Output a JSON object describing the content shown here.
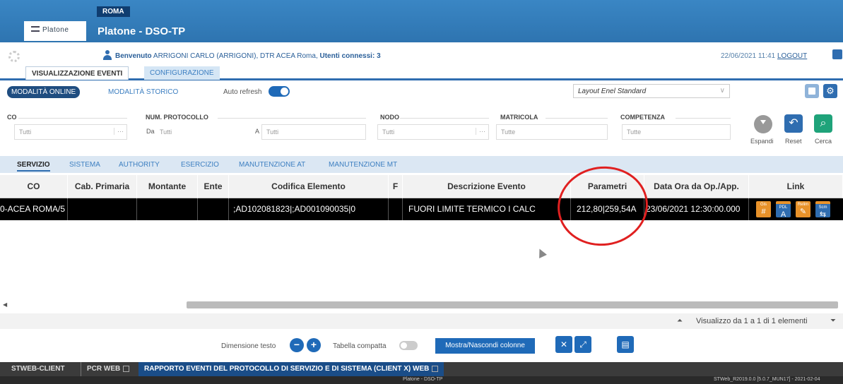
{
  "header": {
    "city_tag": "ROMA",
    "logo_text": "Platone",
    "title": "Platone - DSO-TP"
  },
  "userbar": {
    "welcome_label": "Benvenuto",
    "user": "ARRIGONI CARLO (ARRIGONI), DTR ACEA Roma,",
    "users_connected_label": "Utenti connessi: 3",
    "datetime": "22/06/2021  11:41",
    "logout": "LOGOUT"
  },
  "main_tabs": [
    "VISUALIZZAZIONE EVENTI",
    "CONFIGURAZIONE"
  ],
  "mode": {
    "online": "MODALITÀ ONLINE",
    "storico": "MODALITÀ STORICO",
    "auto_refresh": "Auto refresh",
    "auto_refresh_on": true,
    "layout": "Layout Enel Standard"
  },
  "filters": {
    "co": {
      "label": "CO",
      "value": "Tutti"
    },
    "protocollo": {
      "label": "NUM. PROTOCOLLO",
      "da": "Da",
      "da_value": "Tutti",
      "a": "A",
      "a_value": "Tutti"
    },
    "nodo": {
      "label": "NODO",
      "value": "Tutti"
    },
    "matricola": {
      "label": "MATRICOLA",
      "value": "Tutte"
    },
    "competenza": {
      "label": "COMPETENZA",
      "value": "Tutte"
    }
  },
  "actions": {
    "espandi": "Espandi",
    "reset": "Reset",
    "cerca": "Cerca"
  },
  "category_tabs": [
    "SERVIZIO",
    "SISTEMA",
    "AUTHORITY",
    "ESERCIZIO",
    "MANUTENZIONE AT",
    "MANUTENZIONE MT"
  ],
  "table": {
    "columns": [
      "CO",
      "Cab. Primaria",
      "Montante",
      "Ente",
      "Codifica Elemento",
      "F",
      "Descrizione Evento",
      "Parametri",
      "Data Ora da Op./App.",
      "Link"
    ],
    "rows": [
      {
        "co": "0-ACEA ROMA/5",
        "cab_primaria": "",
        "montante": "",
        "ente": "",
        "codifica": ";AD102081823|;AD001090035|0",
        "f": "",
        "descrizione": "FUORI LIMITE TERMICO I CALC",
        "parametri": "212,80|259,54A",
        "data_ora": "23/06/2021 12:30:00.000"
      }
    ],
    "link_icons": [
      {
        "top": "Gis",
        "glyph": "#",
        "color": "#e8922a"
      },
      {
        "top": "PDL",
        "glyph": "A",
        "sub": "sel",
        "color": "#2f6db0"
      },
      {
        "top": "Relim",
        "glyph": "✎",
        "color": "#e8922a"
      },
      {
        "top": "Scm",
        "glyph": "⇆",
        "color": "#2f6db0"
      }
    ]
  },
  "pager": {
    "info": "Visualizzo da 1 a 1 di 1 elementi"
  },
  "bottom": {
    "dimensione_testo": "Dimensione testo",
    "tabella_compatta": "Tabella compatta",
    "mostra": "Mostra/Nascondi colonne"
  },
  "taskbar": {
    "tasks": [
      "STWEB-CLIENT",
      "PCR WEB",
      "RAPPORTO EVENTI DEL PROTOCOLLO DI SERVIZIO E DI SISTEMA (CLIENT X) WEB"
    ],
    "status_center": "Platone - DSO-TP",
    "status_right": "STWeb_R2019.0.0 [5.0.7_MUN17] - 2021-02-04"
  }
}
